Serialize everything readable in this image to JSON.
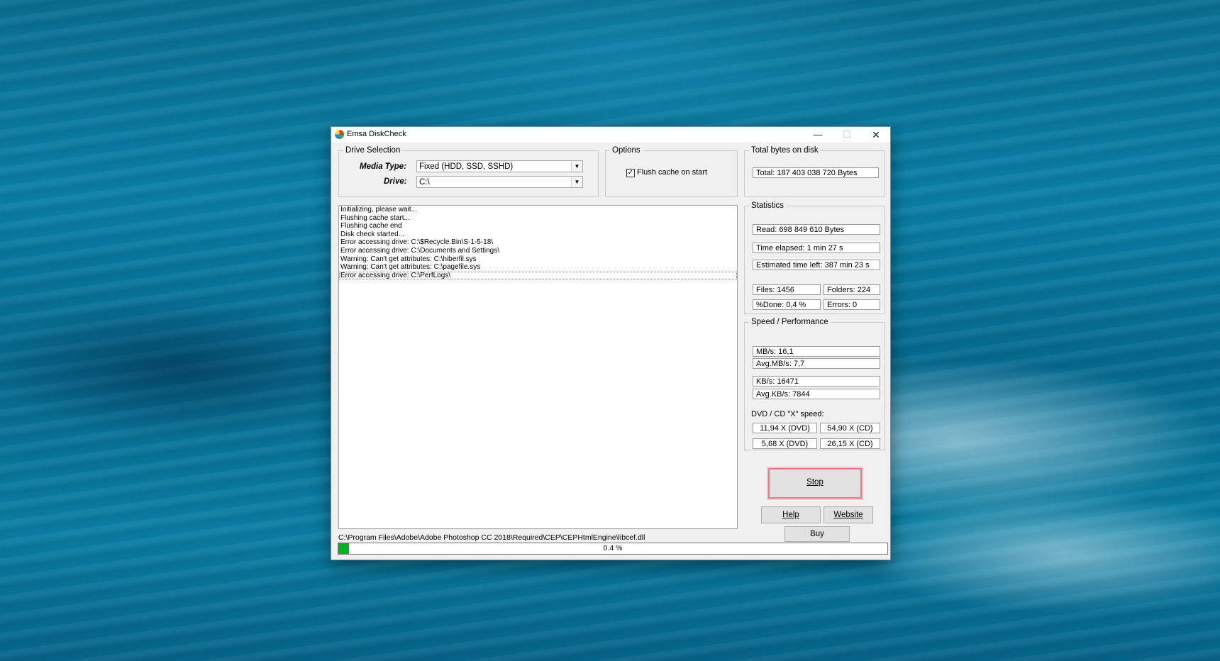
{
  "window": {
    "title": "Emsa DiskCheck",
    "controls": {
      "minimize": "—",
      "maximize": "☐",
      "close": "✕"
    }
  },
  "drive_selection": {
    "legend": "Drive Selection",
    "media_type_label": "Media Type:",
    "media_type_value": "Fixed (HDD, SSD, SSHD)",
    "drive_label": "Drive:",
    "drive_value": "C:\\"
  },
  "options": {
    "legend": "Options",
    "flush_cache_label": "Flush cache on start",
    "flush_cache_checked": true
  },
  "total_bytes": {
    "legend": "Total bytes on disk",
    "value": "Total: 187 403 038 720 Bytes"
  },
  "log": {
    "lines": [
      "Initializing, please wait...",
      "Flushing cache start...",
      "Flushing cache end",
      "Disk check started...",
      "Error accessing drive: C:\\$Recycle.Bin\\S-1-5-18\\",
      "Error accessing drive: C:\\Documents and Settings\\",
      "Warning: Can't get attributes: C:\\hiberfil.sys",
      "Warning: Can't get attributes: C:\\pagefile.sys",
      "Error accessing drive: C:\\PerfLogs\\"
    ]
  },
  "statistics": {
    "legend": "Statistics",
    "read": "Read: 698 849 610 Bytes",
    "time_elapsed": "Time elapsed: 1 min 27 s",
    "time_left": "Estimated time left: 387 min 23 s",
    "files": "Files:  1456",
    "folders": "Folders:  224",
    "done": "%Done:  0,4 %",
    "errors": "Errors:  0"
  },
  "speed": {
    "legend": "Speed / Performance",
    "mbs": "MB/s: 16,1",
    "avg_mbs": "Avg.MB/s: 7,7",
    "kbs": "KB/s: 16471",
    "avg_kbs": "Avg.KB/s: 7844",
    "x_speed_label": "DVD / CD \"X\" speed:",
    "dvd": "11,94 X (DVD)",
    "cd": "54,90 X (CD)",
    "avg_dvd": "5,68 X (DVD)",
    "avg_cd": "26,15 X (CD)"
  },
  "buttons": {
    "stop": "Stop",
    "help": "Help",
    "website": "Website",
    "buy": "Buy"
  },
  "status": {
    "current_path": "C:\\Program Files\\Adobe\\Adobe Photoshop CC 2018\\Required\\CEP\\CEPHtmlEngine\\libcef.dll",
    "progress_text": "0.4 %",
    "progress_value": 0.004
  },
  "colors": {
    "progress_fill": "#06b025",
    "stop_focus_border": "#e07f85"
  }
}
